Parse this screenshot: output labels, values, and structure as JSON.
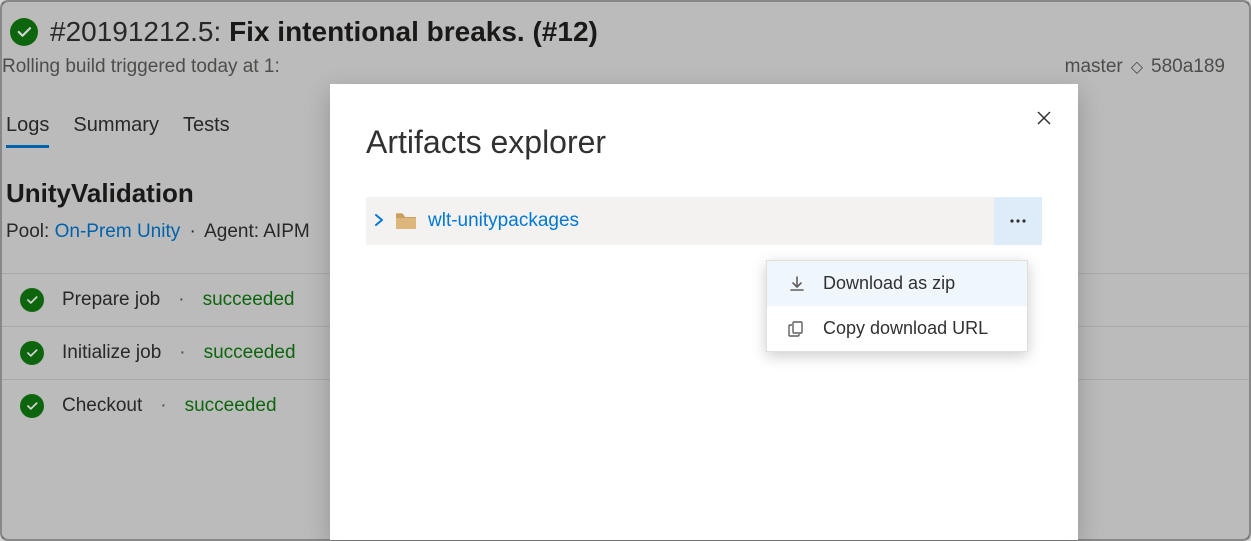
{
  "header": {
    "build_number": "#20191212.5:",
    "build_title": "Fix intentional breaks. (#12)"
  },
  "sub": {
    "trigger_text": "Rolling build triggered today at 1:",
    "branch": "master",
    "commit": "580a189"
  },
  "tabs": {
    "logs": "Logs",
    "summary": "Summary",
    "tests": "Tests"
  },
  "section": {
    "title": "UnityValidation",
    "pool_label": "Pool:",
    "pool_name": "On-Prem Unity",
    "agent_label": "Agent: AIPM"
  },
  "steps": [
    {
      "name": "Prepare job",
      "status": "succeeded"
    },
    {
      "name": "Initialize job",
      "status": "succeeded"
    },
    {
      "name": "Checkout",
      "status": "succeeded"
    }
  ],
  "modal": {
    "title": "Artifacts explorer",
    "artifact_name": "wlt-unitypackages"
  },
  "menu": {
    "download": "Download as zip",
    "copy_url": "Copy download URL"
  }
}
